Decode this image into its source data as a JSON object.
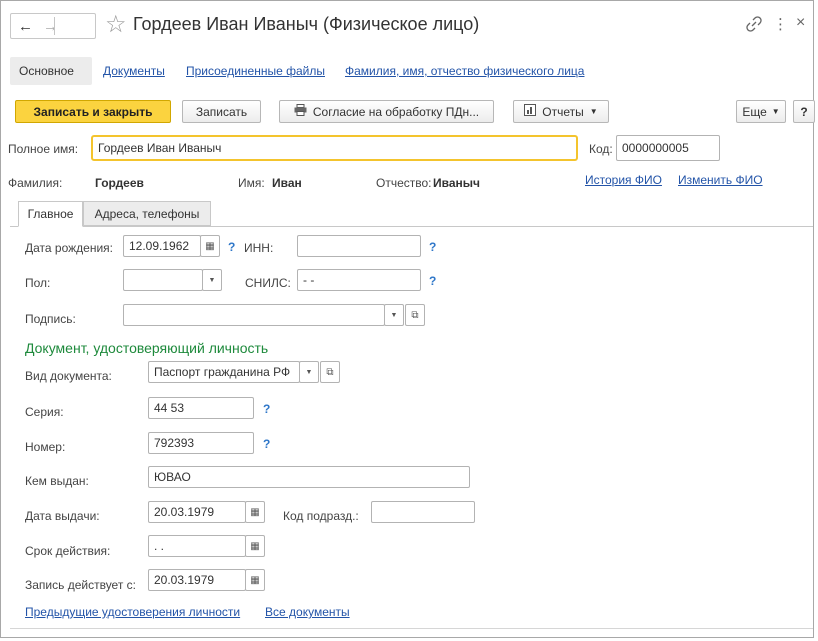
{
  "window": {
    "title": "Гордеев Иван Иваныч (Физическое лицо)",
    "nav_back": "←",
    "nav_forward": "→",
    "star": "☆",
    "link_icon": "link-icon",
    "more_icon": "⋮",
    "close_icon": "×"
  },
  "nav_tabs": [
    {
      "label": "Основное"
    },
    {
      "label": "Документы"
    },
    {
      "label": "Присоединенные файлы"
    },
    {
      "label": "Фамилия, имя, отчество физического лица"
    }
  ],
  "toolbar": {
    "save_close": "Записать и закрыть",
    "save": "Записать",
    "consent": "Согласие на обработку ПДн...",
    "reports": "Отчеты",
    "more": "Еще",
    "help": "?"
  },
  "header": {
    "full_name_label": "Полное имя:",
    "full_name_value": "Гордеев Иван Иваныч",
    "code_label": "Код:",
    "code_value": "0000000005",
    "surname_label": "Фамилия:",
    "surname_value": "Гордеев",
    "name_label": "Имя:",
    "name_value": "Иван",
    "patronymic_label": "Отчество:",
    "patronymic_value": "Иваныч",
    "history_link": "История ФИО",
    "change_link": "Изменить ФИО"
  },
  "tabs": [
    {
      "label": "Главное"
    },
    {
      "label": "Адреса, телефоны"
    }
  ],
  "main": {
    "birth_label": "Дата рождения:",
    "birth_value": "12.09.1962",
    "inn_label": "ИНН:",
    "inn_value": "",
    "sex_label": "Пол:",
    "sex_value": "",
    "snils_label": "СНИЛС:",
    "snils_value": "-   -",
    "signature_label": "Подпись:",
    "signature_value": "",
    "help_mark": "?",
    "doc_section_title": "Документ, удостоверяющий личность",
    "doc_type_label": "Вид документа:",
    "doc_type_value": "Паспорт гражданина РФ",
    "series_label": "Серия:",
    "series_value": "44 53",
    "number_label": "Номер:",
    "number_value": "792393",
    "issued_by_label": "Кем выдан:",
    "issued_by_value": "ЮВАО",
    "issue_date_label": "Дата выдачи:",
    "issue_date_value": "20.03.1979",
    "dept_code_label": "Код подразд.:",
    "dept_code_value": "",
    "validity_label": "Срок действия:",
    "validity_value": ".   .",
    "valid_from_label": "Запись действует с:",
    "valid_from_value": "20.03.1979",
    "prev_docs_link": "Предыдущие удостоверения личности",
    "all_docs_link": "Все документы"
  },
  "colors": {
    "accent": "#fbd33f",
    "link": "#2354a8",
    "section_green": "#1e8a3c",
    "help_blue": "#2f77c9"
  }
}
